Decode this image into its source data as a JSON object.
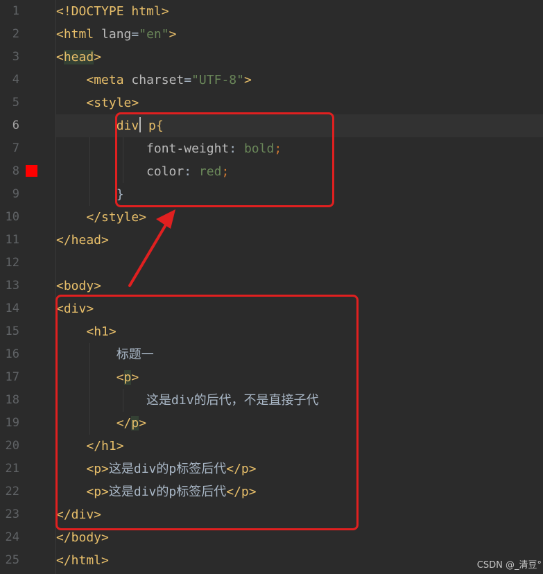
{
  "gutter": {
    "line_numbers": [
      "1",
      "2",
      "3",
      "4",
      "5",
      "6",
      "7",
      "8",
      "9",
      "10",
      "11",
      "12",
      "13",
      "14",
      "15",
      "16",
      "17",
      "18",
      "19",
      "20",
      "21",
      "22",
      "23",
      "24",
      "25"
    ],
    "current_line": "6",
    "breakpoint_line": "8"
  },
  "code": {
    "l1": {
      "a": "<!DOCTYPE html>"
    },
    "l2": {
      "open": "<html ",
      "attr": "lang",
      "eq": "=",
      "val": "\"en\"",
      "close": ">"
    },
    "l3": {
      "lt": "<",
      "tag": "head",
      "gt": ">"
    },
    "l4": {
      "open": "<meta ",
      "attr": "charset",
      "eq": "=",
      "val": "\"UTF-8\"",
      "close": ">"
    },
    "l5": {
      "a": "<style>"
    },
    "l6": {
      "sel1": "div",
      "sel2": " p{"
    },
    "l7": {
      "prop": "font-weight",
      "colon": ": ",
      "val": "bold",
      "semi": ";"
    },
    "l8": {
      "prop": "color",
      "colon": ": ",
      "val": "red",
      "semi": ";"
    },
    "l9": {
      "a": "}"
    },
    "l10": {
      "a": "</style>"
    },
    "l11": {
      "a": "</head>"
    },
    "l12": {
      "a": ""
    },
    "l13": {
      "a": "<body>"
    },
    "l14": {
      "a": "<div>"
    },
    "l15": {
      "a": "<h1>"
    },
    "l16": {
      "text": "标题一"
    },
    "l17": {
      "lt": "<",
      "tag": "p",
      "gt": ">"
    },
    "l18": {
      "t1": "这是",
      "t2": "div",
      "t3": "的后代，不是直接子代"
    },
    "l19": {
      "lt": "</",
      "tag": "p",
      "gt": ">"
    },
    "l20": {
      "a": "</h1>"
    },
    "l21": {
      "open": "<p>",
      "t1": "这是",
      "t2": "div",
      "t3": "的",
      "t4": "p",
      "t5": "标签后代",
      "close": "</p>"
    },
    "l22": {
      "open": "<p>",
      "t1": "这是",
      "t2": "div",
      "t3": "的",
      "t4": "p",
      "t5": "标签后代",
      "close": "</p>"
    },
    "l23": {
      "a": "</div>"
    },
    "l24": {
      "a": "</body>"
    },
    "l25": {
      "a": "</html>"
    }
  },
  "annotations": {
    "box_color": "#e02020",
    "arrow_color": "#e02020"
  },
  "watermark": "CSDN @_清豆°"
}
